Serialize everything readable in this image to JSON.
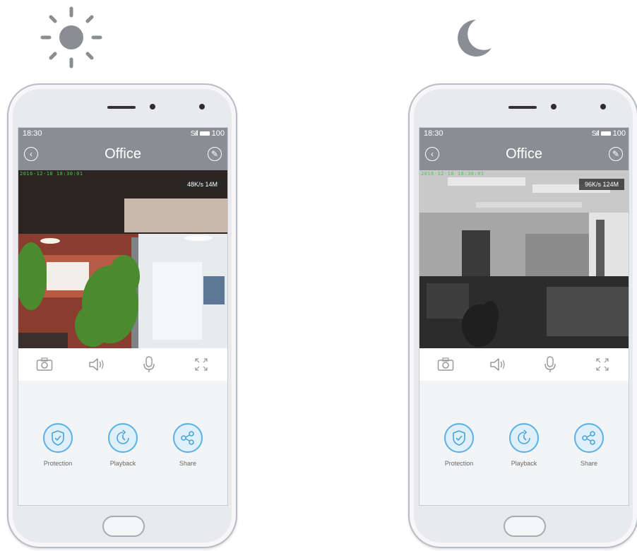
{
  "scenes": {
    "day": {
      "status": {
        "time": "18:30",
        "signal": "Sıll",
        "battery": "100"
      },
      "title": "Office",
      "timestamp": "2016-12-18 18:30:01",
      "rate": "48K/s 14M"
    },
    "night": {
      "status": {
        "time": "18:30",
        "signal": "Sıll",
        "battery": "100"
      },
      "title": "Office",
      "timestamp": "2016-12-18 18:30:01",
      "rate": "96K/s 124M"
    }
  },
  "controls": [
    "camera-icon",
    "speaker-icon",
    "microphone-icon",
    "fullscreen-icon"
  ],
  "actions": [
    {
      "label": "Protection",
      "icon": "shield-check-icon"
    },
    {
      "label": "Playback",
      "icon": "clock-history-icon"
    },
    {
      "label": "Share",
      "icon": "share-icon"
    }
  ],
  "colors": {
    "accent": "#5bb0e6",
    "header": "#8a8d93",
    "sun": "#8a8d93",
    "moon": "#8a8d93"
  }
}
